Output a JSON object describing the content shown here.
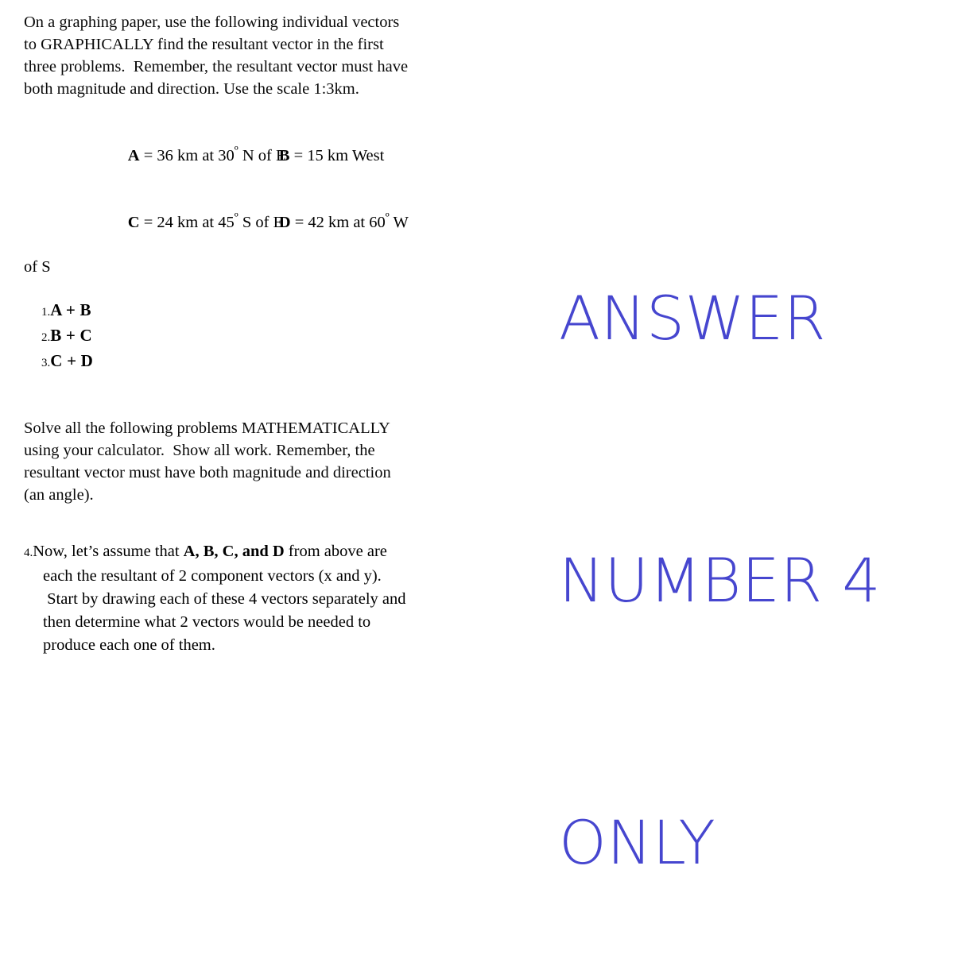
{
  "document": {
    "intro_paragraph": {
      "lines": [
        "On a graphing paper, use the following individual vectors",
        "to GRAPHICALLY find the resultant vector in the first",
        "three problems.  Remember, the resultant vector must have",
        "both magnitude and direction. Use the scale 1:3km."
      ]
    },
    "vector_definitions": {
      "rows": [
        {
          "left": {
            "name": "A",
            "eq": " = 36 km at 30",
            "degree": "º",
            "tail": " N of E"
          },
          "right": {
            "name": "B",
            "eq": " = 15 km West",
            "degree": "",
            "tail": ""
          }
        },
        {
          "left": {
            "name": "C",
            "eq": " = 24 km at 45",
            "degree": "º",
            "tail": " S of E"
          },
          "right": {
            "name": "D",
            "eq": " = 42 km at 60",
            "degree": "º",
            "tail": " W"
          }
        }
      ],
      "wrapped_tail": "of S"
    },
    "problem_list": [
      {
        "marker": "1.",
        "text": "A + B"
      },
      {
        "marker": "2.",
        "text": "B + C"
      },
      {
        "marker": "3.",
        "text": "C + D"
      }
    ],
    "math_paragraph": {
      "lines": [
        "Solve all the following problems MATHEMATICALLY",
        "using your calculator.  Show all work. Remember, the",
        "resultant vector must have both magnitude and direction",
        "(an angle)."
      ]
    },
    "item_four": {
      "marker": "4.",
      "line1_before_bold": "Now, let’s assume that ",
      "line1_bold": "A, B, C, and D",
      "line1_after_bold": " from above are",
      "line2": "each the resultant of 2 component vectors (x and y).",
      "line3": " Start by drawing each of these 4 vectors separately and",
      "line4": "then determine what 2 vectors would be needed to",
      "line5": "produce each one of them."
    }
  },
  "answer_note": {
    "line1": "ANSWER",
    "line2": "NUMBER 4",
    "line3": "ONLY",
    "color": "#4646cf"
  }
}
